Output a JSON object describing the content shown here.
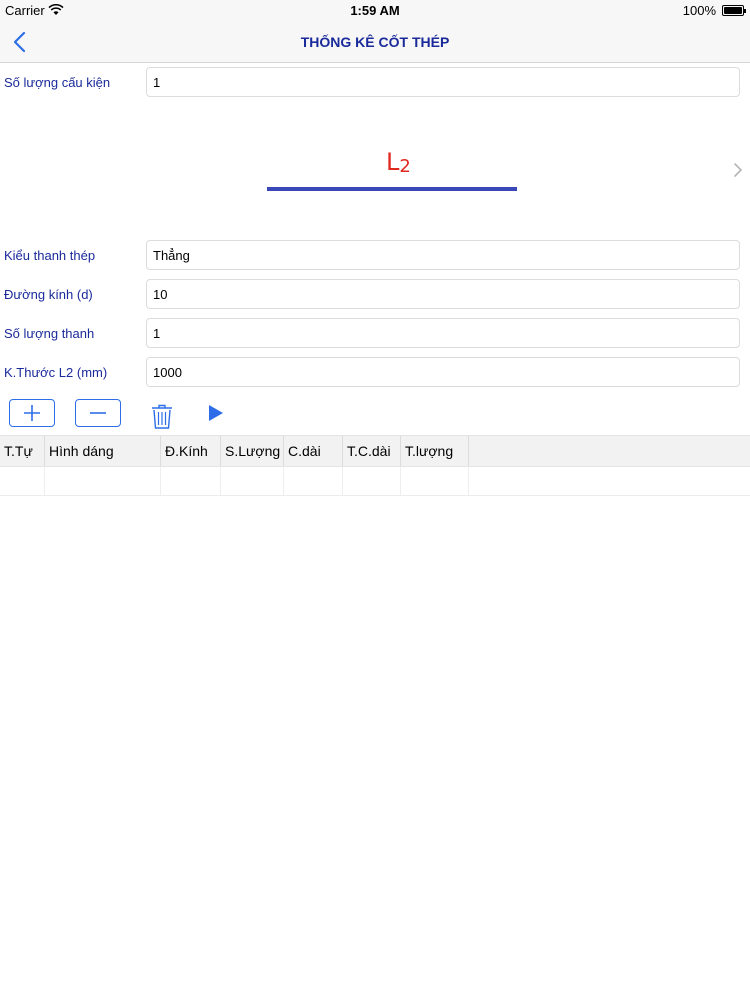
{
  "status_bar": {
    "carrier": "Carrier",
    "time": "1:59 AM",
    "battery": "100%"
  },
  "nav": {
    "title": "THỐNG KÊ CỐT THÉP"
  },
  "form_top": {
    "label": "Số lượng cấu kiện",
    "value": "1"
  },
  "diagram": {
    "label_main": "L",
    "label_sub": "2",
    "label_color": "#e0281e",
    "bar_color": "#3a47b8"
  },
  "form": {
    "kieu_thanh_thep": {
      "label": "Kiểu thanh thép",
      "value": "Thẳng"
    },
    "duong_kinh": {
      "label": "Đường kính (d)",
      "value": "10"
    },
    "so_luong_thanh": {
      "label": "Số lượng thanh",
      "value": "1"
    },
    "kich_thuoc_l2": {
      "label": "K.Thước L2 (mm)",
      "value": "1000"
    }
  },
  "toolbar": {
    "add_icon": "plus-icon",
    "remove_icon": "minus-icon",
    "delete_icon": "trash-icon",
    "run_icon": "play-icon",
    "accent": "#2d6ee8"
  },
  "table": {
    "headers": [
      "T.Tự",
      "Hình dáng",
      "Đ.Kính",
      "S.Lượng",
      "C.dài",
      "T.C.dài",
      "T.lượng"
    ],
    "rows": [
      [
        "",
        "",
        "",
        "",
        "",
        "",
        ""
      ]
    ]
  },
  "colors": {
    "label": "#1a2a9a",
    "navbar_bg": "#f7f7f7"
  }
}
